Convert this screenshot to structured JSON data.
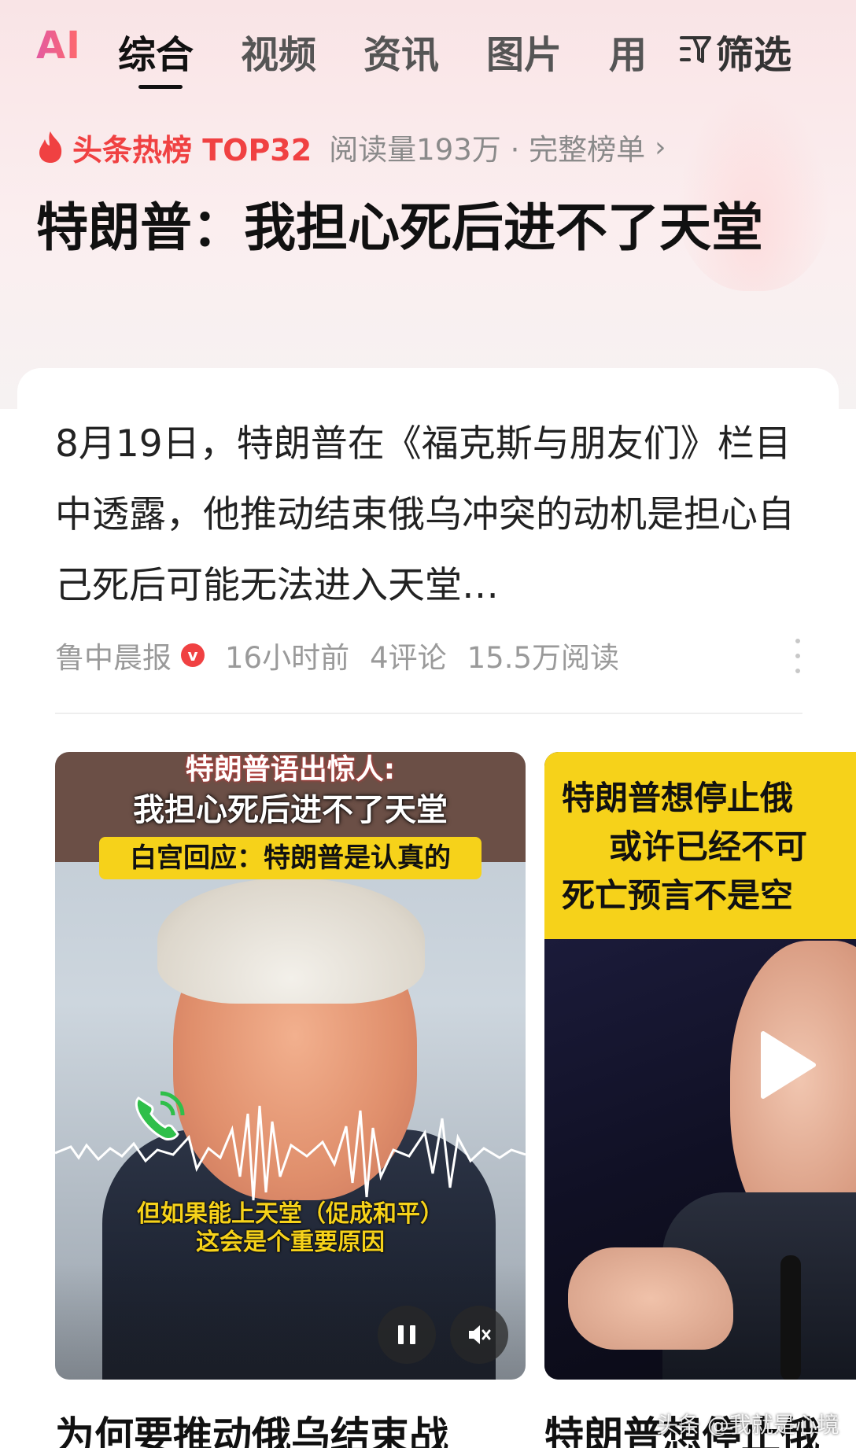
{
  "nav": {
    "ai_label": "AI",
    "tabs": [
      "综合",
      "视频",
      "资讯",
      "图片",
      "用"
    ],
    "active_tab": "综合",
    "filter_label": "筛选"
  },
  "hot": {
    "label": "头条热榜 TOP32",
    "meta": "阅读量193万 · 完整榜单",
    "chevron": "›"
  },
  "headline": "特朗普：我担心死后进不了天堂",
  "article": {
    "summary": "8月19日，特朗普在《福克斯与朋友们》栏目中透露，他推动结束俄乌冲突的动机是担心自己死后可能无法进入天堂…",
    "source": "鲁中晨报",
    "verified_badge": "v",
    "time": "16小时前",
    "comments": "4评论",
    "reads": "15.5万阅读"
  },
  "video1": {
    "caption1": "特朗普语出惊人:",
    "caption2": "我担心死后进不了天堂",
    "caption3": "白宫回应：特朗普是认真的",
    "caption4_line1": "但如果能上天堂（促成和平）",
    "caption4_line2": "这会是个重要原因",
    "title": "为何要推动俄乌结束战"
  },
  "video2": {
    "line1": "特朗普想停止俄",
    "line2": "或许已经不可",
    "line3": "死亡预言不是空",
    "title": "特朗普想停止俄"
  },
  "watermark": "头条 @我就是心境",
  "colors": {
    "accent_red": "#f04142",
    "caption_yellow": "#f6d21a"
  }
}
